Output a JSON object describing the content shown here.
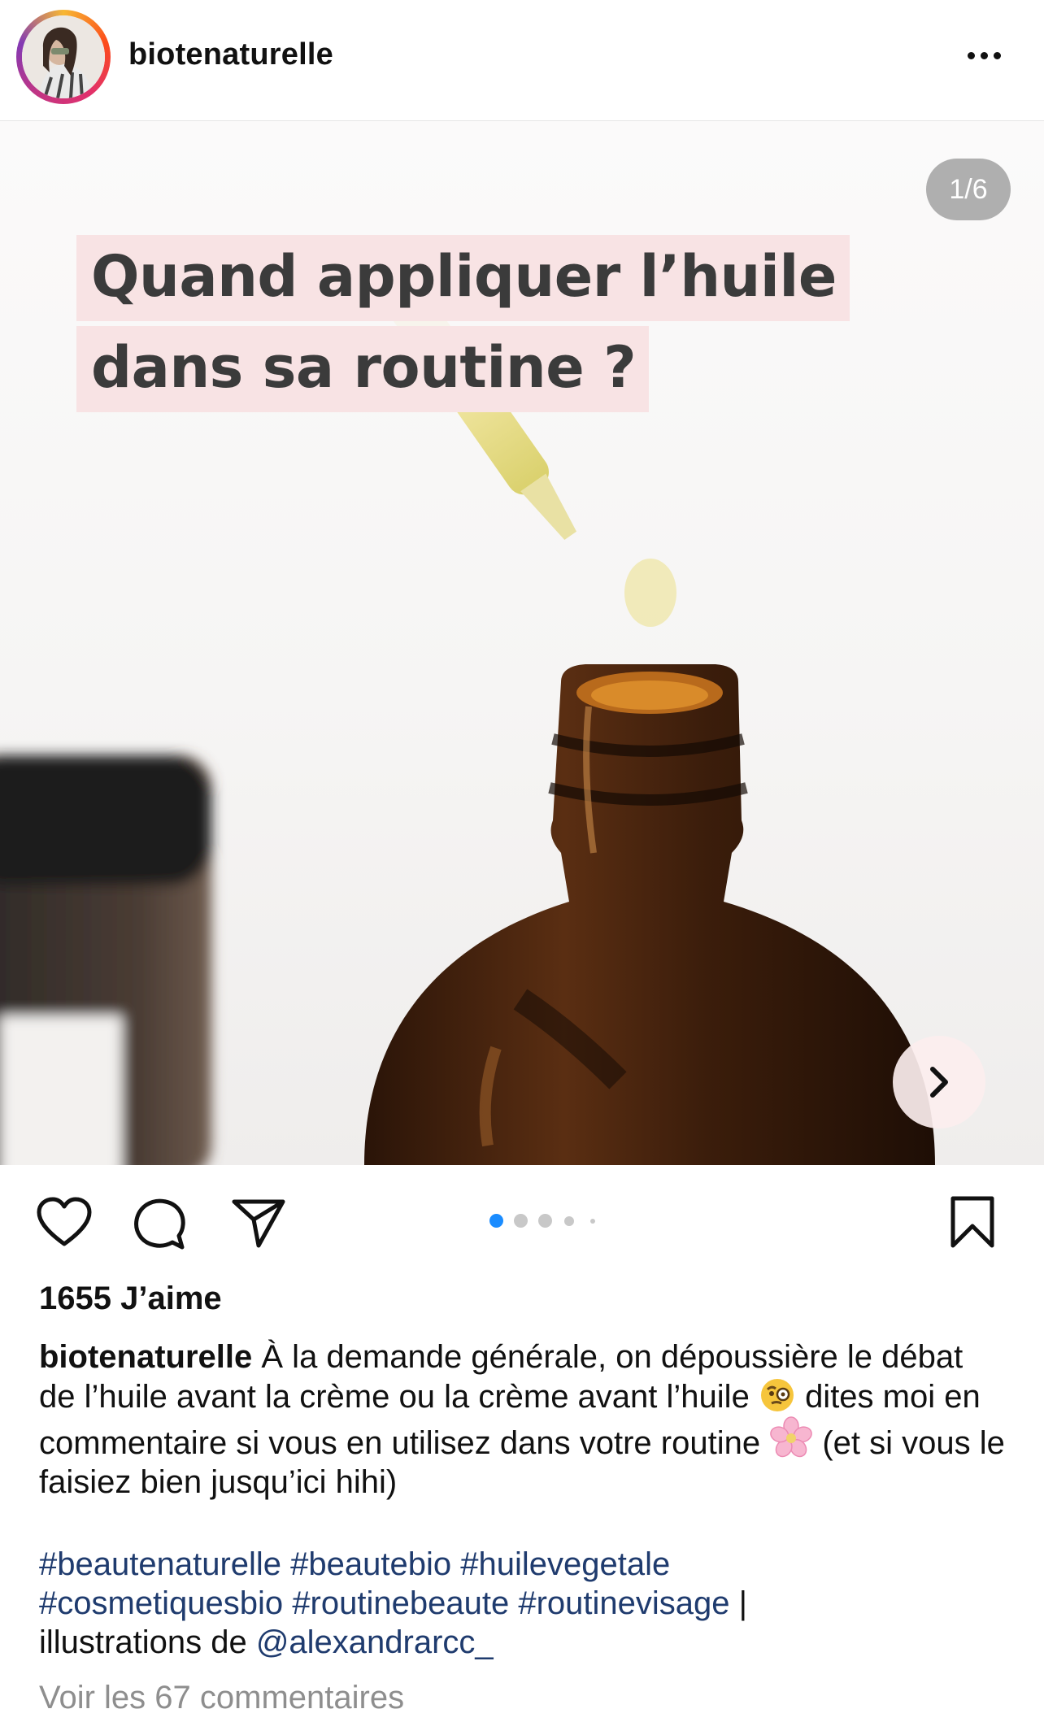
{
  "post": {
    "username": "biotenaturelle",
    "counter": "1/6",
    "headline": [
      "Quand appliquer l’huile",
      "dans sa routine ?"
    ],
    "likes": "1655 J’aime",
    "caption": {
      "username": "biotenaturelle",
      "text1": "À la demande générale, on dépoussière le débat de l’huile avant la crème ou la crème avant l’huile",
      "text2": "dites moi en commentaire si vous en utilisez dans votre routine",
      "text3": "(et si vous le faisiez bien jusqu’ici hihi)"
    },
    "hashtags": [
      "#beautenaturelle",
      "#beautebio",
      "#huilevegetale",
      "#cosmetiquesbio",
      "#routinebeaute",
      "#routinevisage"
    ],
    "separator": "|",
    "credit_prefix": "illustrations de",
    "credit_mention": "@alexandrarcc_",
    "comments_link": "Voir les 67 commentaires"
  },
  "carousel": {
    "total": 6,
    "active": 1
  },
  "icons": {
    "more": "more-horizontal-icon",
    "like": "heart-icon",
    "comment": "comment-icon",
    "share": "paper-plane-icon",
    "save": "bookmark-icon",
    "next": "chevron-right-icon",
    "emoji1": "face-with-monocle-emoji",
    "emoji2": "cherry-blossom-emoji"
  },
  "colors": {
    "hashtag": "#1f3b6e",
    "dot_active": "#1a8cff",
    "headline_highlight": "#f8e3e4"
  }
}
